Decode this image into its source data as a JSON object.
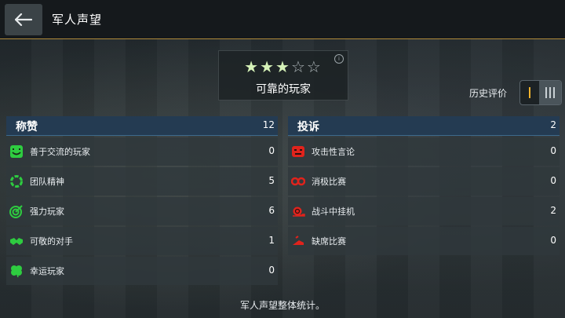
{
  "header": {
    "title": "军人声望",
    "back_icon": "arrow-left-icon"
  },
  "rating": {
    "stars_filled": 3,
    "stars_total": 5,
    "label": "可靠的玩家",
    "info_icon_glyph": "i"
  },
  "history": {
    "label": "历史评价"
  },
  "praise": {
    "title": "称赞",
    "total": "12",
    "items": [
      {
        "label": "善于交流的玩家",
        "count": "0",
        "icon": "smile-face-icon",
        "color": "#2ecc40"
      },
      {
        "label": "团队精神",
        "count": "5",
        "icon": "team-circle-icon",
        "color": "#2ecc40"
      },
      {
        "label": "强力玩家",
        "count": "6",
        "icon": "target-icon",
        "color": "#2ecc40"
      },
      {
        "label": "可敬的对手",
        "count": "1",
        "icon": "handshake-icon",
        "color": "#2ecc40"
      },
      {
        "label": "幸运玩家",
        "count": "0",
        "icon": "clover-icon",
        "color": "#2ecc40"
      }
    ]
  },
  "complaints": {
    "title": "投诉",
    "total": "2",
    "items": [
      {
        "label": "攻击性言论",
        "count": "0",
        "icon": "angry-face-icon",
        "color": "#e0231c"
      },
      {
        "label": "消极比赛",
        "count": "0",
        "icon": "handcuffs-icon",
        "color": "#e0231c"
      },
      {
        "label": "战斗中挂机",
        "count": "2",
        "icon": "snail-icon",
        "color": "#e0231c"
      },
      {
        "label": "缺席比赛",
        "count": "0",
        "icon": "running-away-icon",
        "color": "#e0231c"
      }
    ]
  },
  "footer": {
    "text": "军人声望整体统计。"
  }
}
